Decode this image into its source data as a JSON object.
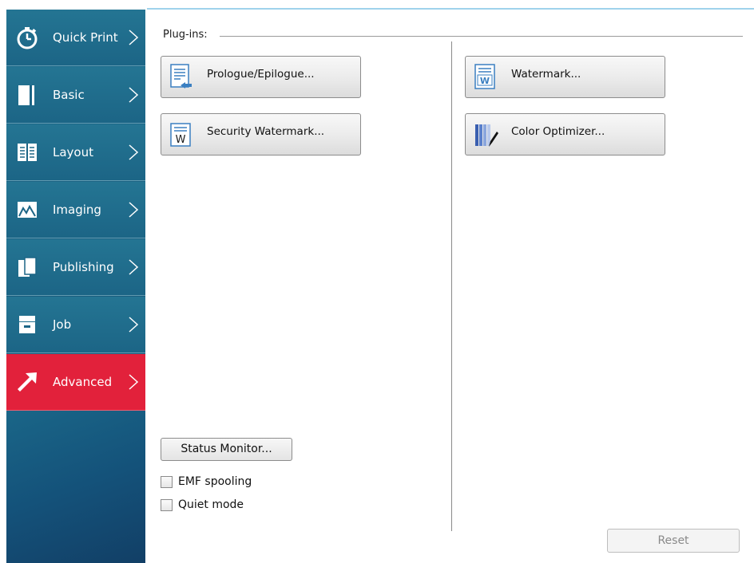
{
  "sidebar": {
    "items": [
      {
        "label": "Quick Print",
        "icon": "stopwatch-icon",
        "active": false
      },
      {
        "label": "Basic",
        "icon": "page-icon",
        "active": false
      },
      {
        "label": "Layout",
        "icon": "layout-icon",
        "active": false
      },
      {
        "label": "Imaging",
        "icon": "image-icon",
        "active": false
      },
      {
        "label": "Publishing",
        "icon": "publishing-icon",
        "active": false
      },
      {
        "label": "Job",
        "icon": "job-icon",
        "active": false
      },
      {
        "label": "Advanced",
        "icon": "arrow-icon",
        "active": true
      }
    ]
  },
  "plugins": {
    "label": "Plug-ins:",
    "buttons": {
      "prologue": "Prologue/Epilogue...",
      "watermark": "Watermark...",
      "security_watermark": "Security Watermark...",
      "color_optimizer": "Color Optimizer..."
    }
  },
  "status_monitor": "Status Monitor...",
  "options": {
    "emf_spooling": {
      "label": "EMF spooling",
      "checked": false
    },
    "quiet_mode": {
      "label": "Quiet mode",
      "checked": false
    }
  },
  "reset": {
    "label": "Reset",
    "enabled": false
  },
  "colors": {
    "sidebar": "#1c6586",
    "active": "#e2213b",
    "accent_line": "#9fd3ec"
  }
}
